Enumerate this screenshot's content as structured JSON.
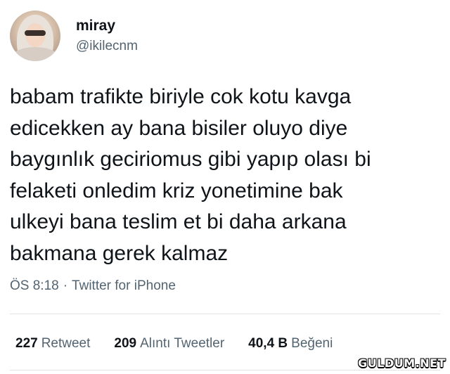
{
  "author": {
    "display_name": "miray",
    "handle": "@ikilecnm"
  },
  "tweet": {
    "lines": [
      "babam trafikte biriyle cok kotu kavga",
      "edicekken ay bana bisiler oluyo diye",
      "baygınlık geciriomus gibi yapıp olası bi",
      "felaketi onledim kriz yonetimine bak",
      "ulkeyi bana teslim et bi daha arkana",
      "bakmana gerek kalmaz"
    ],
    "time": "ÖS 8:18",
    "separator": "·",
    "source": "Twitter for iPhone"
  },
  "stats": {
    "retweets_count": "227",
    "retweets_label": "Retweet",
    "quotes_count": "209",
    "quotes_label": "Alıntı Tweetler",
    "likes_count": "40,4 B",
    "likes_label": "Beğeni"
  },
  "watermark": "GULDUM.NET",
  "colors": {
    "text": "#0f1419",
    "secondary": "#536471",
    "divider": "#dfe3e6"
  }
}
